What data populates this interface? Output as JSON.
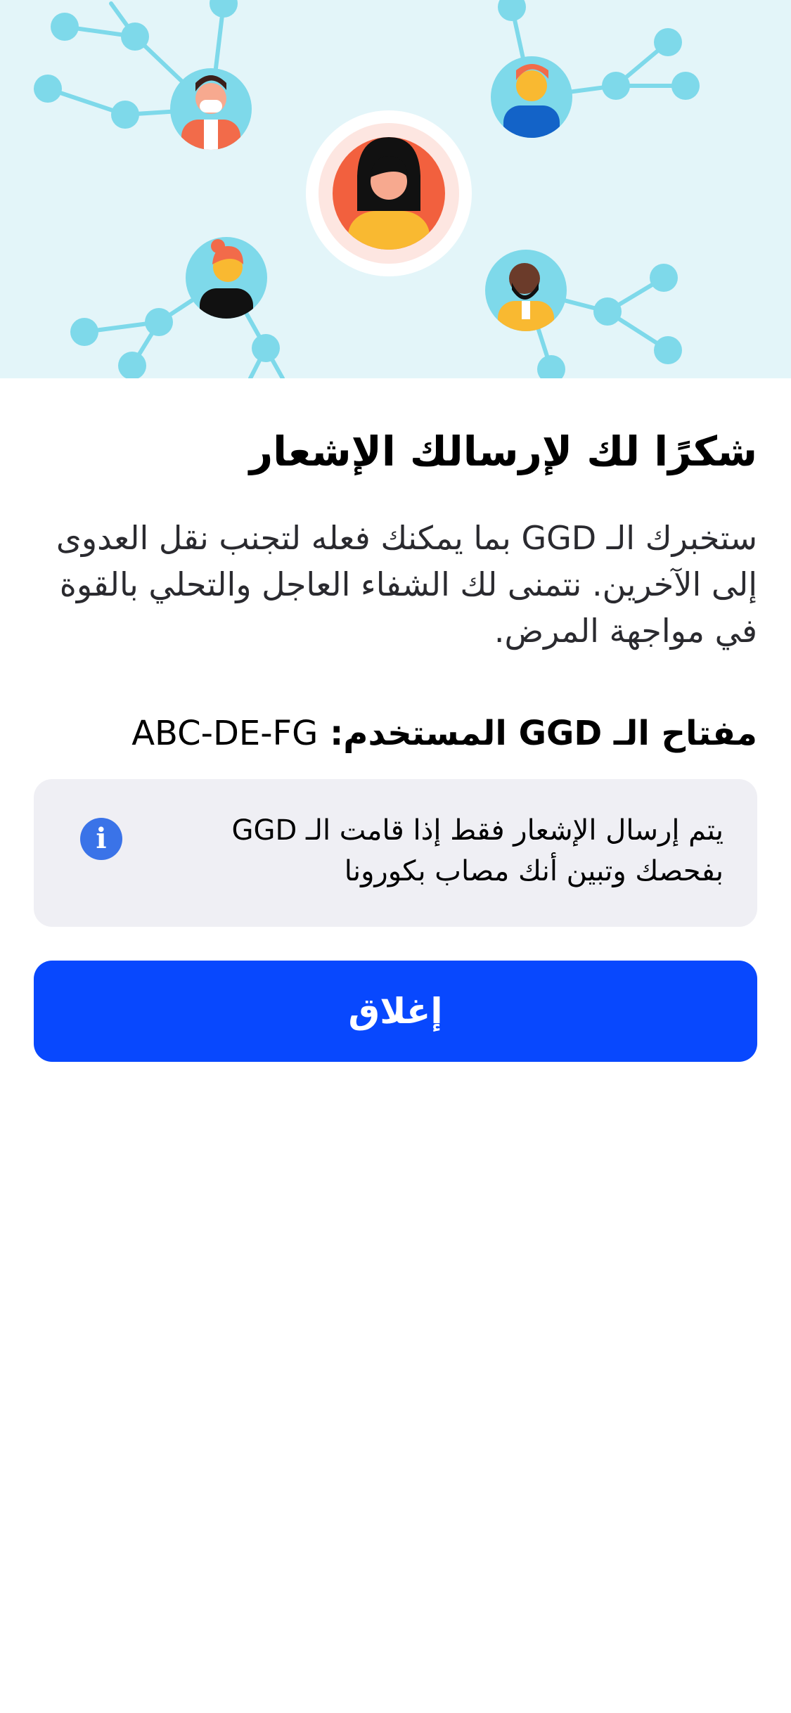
{
  "thanks_screen": {
    "title": "شكرًا لك لإرسالك الإشعار",
    "body": "ستخبرك الـ GGD بما يمكنك فعله لتجنب نقل العدوى إلى الآخرين. نتمنى لك الشفاء العاجل والتحلي بالقوة في مواجهة المرض.",
    "key_label": "مفتاح الـ GGD المستخدم: ",
    "key_value": "ABC-DE-FG",
    "info_text": "يتم إرسال الإشعار فقط إذا قامت الـ GGD بفحصك وتبين أنك مصاب بكورونا",
    "info_icon_glyph": "i",
    "close_label": "إغلاق"
  },
  "icons": {
    "info": "info-icon",
    "hero": "contact-network-illustration"
  },
  "colors": {
    "hero_background": "#e3f5f9",
    "network_line": "#7ed9ea",
    "info_card": "#efeff4",
    "info_icon": "#3a73e8",
    "primary_button": "#0848fe",
    "button_text": "#ffffff"
  }
}
